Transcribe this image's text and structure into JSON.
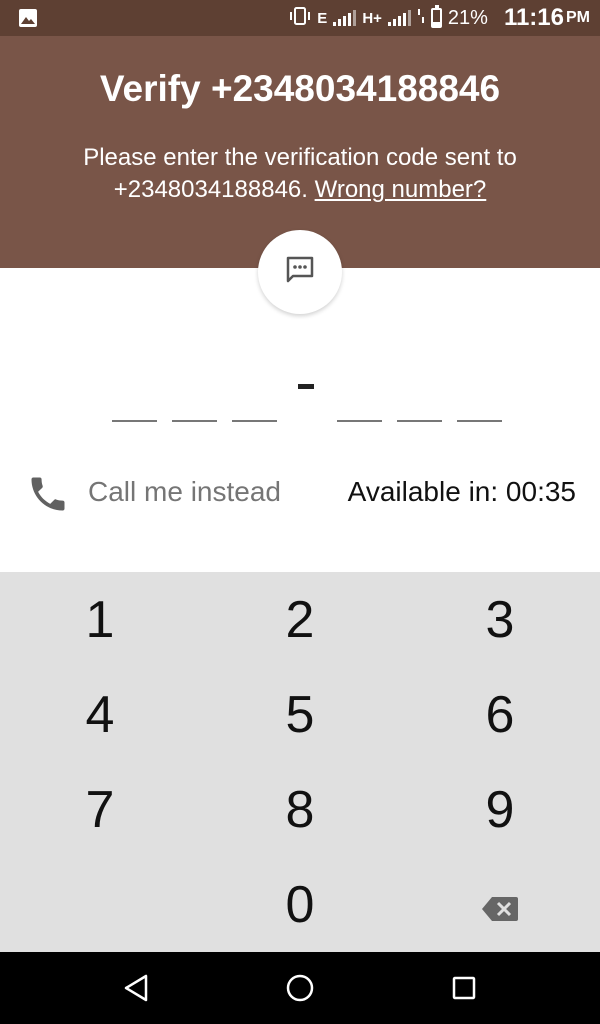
{
  "status_bar": {
    "network_1": "E",
    "network_2": "H+",
    "battery_percent": "21%",
    "time": "11:16",
    "ampm": "PM"
  },
  "header": {
    "title": "Verify +2348034188846",
    "description": "Please enter the verification code sent to +2348034188846.",
    "wrong_number_link": "Wrong number?",
    "background_color": "#795548"
  },
  "sms_icon": "sms-message-icon",
  "code_entry": {
    "slots": 6,
    "separator": "-",
    "values": [
      "",
      "",
      "",
      "",
      "",
      ""
    ]
  },
  "call": {
    "icon": "phone-icon",
    "label": "Call me instead",
    "availability": "Available in: 00:35"
  },
  "keypad": {
    "keys": [
      "1",
      "2",
      "3",
      "4",
      "5",
      "6",
      "7",
      "8",
      "9",
      "",
      "0",
      "backspace"
    ],
    "backspace_icon": "backspace-icon",
    "background_color": "#e0e0e0"
  },
  "navbar": {
    "buttons": [
      "back-icon",
      "home-icon",
      "recents-icon"
    ]
  }
}
